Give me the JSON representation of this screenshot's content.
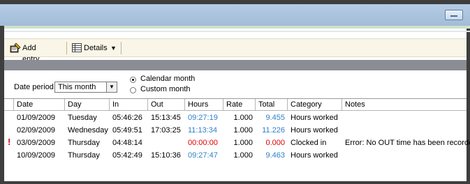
{
  "toolbar": {
    "add_entry_label": "Add entry",
    "details_label": "Details"
  },
  "filter": {
    "date_period_label": "Date period",
    "date_period_value": "This month",
    "radio_calendar_label": "Calendar month",
    "radio_custom_label": "Custom month",
    "selected": "Calendar month"
  },
  "table": {
    "columns": [
      "Date",
      "Day",
      "In",
      "Out",
      "Hours",
      "Rate",
      "Total",
      "Category",
      "Notes"
    ],
    "rows": [
      {
        "date": "01/09/2009",
        "day": "Tuesday",
        "in": "05:46:26",
        "out": "15:13:45",
        "hours": "09:27:19",
        "rate": "1.000",
        "total": "9.455",
        "category": "Hours worked",
        "notes": "",
        "error": false
      },
      {
        "date": "02/09/2009",
        "day": "Wednesday",
        "in": "05:49:51",
        "out": "17:03:25",
        "hours": "11:13:34",
        "rate": "1.000",
        "total": "11.226",
        "category": "Hours worked",
        "notes": "",
        "error": false
      },
      {
        "date": "03/09/2009",
        "day": "Thursday",
        "in": "04:48:14",
        "out": "",
        "hours": "00:00:00",
        "rate": "1.000",
        "total": "0.000",
        "category": "Clocked in",
        "notes": "Error: No OUT time has been recorded",
        "error": true
      },
      {
        "date": "10/09/2009",
        "day": "Thursday",
        "in": "05:42:49",
        "out": "15:10:36",
        "hours": "09:27:47",
        "rate": "1.000",
        "total": "9.463",
        "category": "Hours worked",
        "notes": "",
        "error": false
      }
    ]
  },
  "icons": {
    "add_entry": "add-entry-icon",
    "details": "details-grid-icon",
    "error_flag": "error-flag-icon",
    "minimize": "minimize-icon"
  },
  "colors": {
    "hours_total_ok": "#2f7fc9",
    "error": "#e00000",
    "toolbar_bg": "#f9f6e7",
    "title_bar": "#a9c1dc"
  }
}
